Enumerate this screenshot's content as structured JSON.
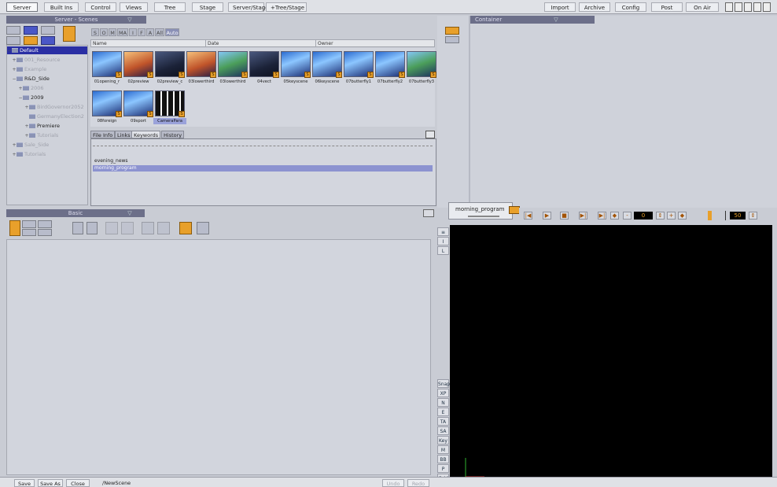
{
  "menu": {
    "left": [
      "Server",
      "Built Ins",
      "Control",
      "Views",
      "Tree",
      "Stage",
      "Server/Stage",
      "+Tree/Stage"
    ],
    "right": [
      "Import",
      "Archive",
      "Config",
      "Post",
      "On Air"
    ]
  },
  "panels": {
    "server_scenes": "Server - Scenes",
    "container": "Container",
    "basic": "Basic"
  },
  "filters": [
    "S",
    "O",
    "M",
    "MA",
    "I",
    "F",
    "A",
    "All",
    "Auto"
  ],
  "columns": [
    "Name",
    "Date",
    "Owner"
  ],
  "tree": [
    {
      "label": "Default",
      "state": "selected"
    },
    {
      "label": "001_Resource",
      "state": "dim"
    },
    {
      "label": "Example",
      "state": "dim"
    },
    {
      "label": "R&D_Side",
      "state": "normal"
    },
    {
      "label": "2006",
      "state": "dim"
    },
    {
      "label": "2009",
      "state": "normal"
    },
    {
      "label": "BirdGovernor2052",
      "state": "dim"
    },
    {
      "label": "GermanyElection2",
      "state": "dim"
    },
    {
      "label": "Premiere",
      "state": "normal"
    },
    {
      "label": "Tutorials",
      "state": "dim"
    },
    {
      "label": "Sale_Side",
      "state": "dim"
    },
    {
      "label": "Tutorials",
      "state": "dim"
    }
  ],
  "scenes": [
    {
      "name": "01opening_r",
      "style": "blue"
    },
    {
      "name": "02preview",
      "style": "warm"
    },
    {
      "name": "02preview_c",
      "style": "dark"
    },
    {
      "name": "03lowerthird",
      "style": "warm"
    },
    {
      "name": "03lowerthird",
      "style": "green"
    },
    {
      "name": "04vect",
      "style": "dark"
    },
    {
      "name": "05keyscene",
      "style": "blue"
    },
    {
      "name": "06keyscene",
      "style": "blue"
    },
    {
      "name": "07butterfly1",
      "style": "blue"
    },
    {
      "name": "07butterfly2",
      "style": "blue"
    },
    {
      "name": "07butterfly3",
      "style": "green"
    },
    {
      "name": "08foreign",
      "style": "blue"
    },
    {
      "name": "09sport",
      "style": "blue"
    },
    {
      "name": "CameraPara",
      "style": "cam",
      "selected": true
    }
  ],
  "info_tabs": [
    "File Info",
    "Links",
    "Keywords",
    "History"
  ],
  "keywords": [
    "evening_news",
    "morning_program"
  ],
  "playback": {
    "scene_label": "morning_program",
    "frame_value": "0",
    "end_value": "50"
  },
  "side_strip_top": [
    "I",
    "L"
  ],
  "side_strip_bottom": [
    "Snap",
    "XP",
    "N",
    "E",
    "TA",
    "SA",
    "Key",
    "M",
    "BB",
    "P",
    "Grid"
  ],
  "bottom": {
    "save": "Save",
    "save_as": "Save As",
    "close": "Close",
    "path": "/NewScene",
    "undo": "Undo",
    "redo": "Redo"
  },
  "colors": {
    "accent_orange": "#e8a02b",
    "panel_header": "#6c6f89",
    "selection_blue": "#2a2fa4"
  }
}
